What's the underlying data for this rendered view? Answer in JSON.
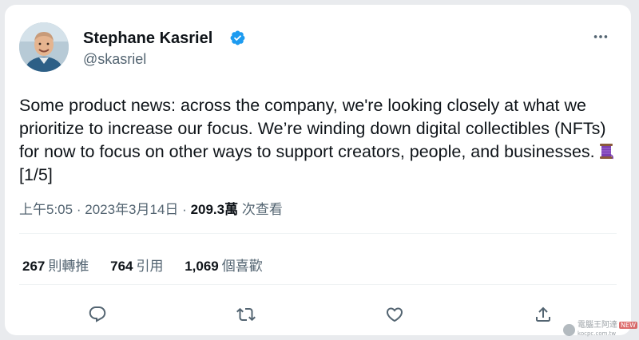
{
  "author": {
    "display_name": "Stephane Kasriel",
    "handle": "@skasriel",
    "verified": true
  },
  "tweet": {
    "text": "Some product news: across the company, we're looking closely at what we prioritize to increase our focus. We’re winding down digital collectibles (NFTs) for now to focus on other ways to support creators, people, and businesses.",
    "thread_marker": "[1/5]",
    "emoji": "spool-of-thread"
  },
  "meta": {
    "time": "上午5:05",
    "separator": "·",
    "date": "2023年3月14日",
    "views_count": "209.3萬",
    "views_label": "次查看"
  },
  "stats": [
    {
      "count": "267",
      "label": "則轉推"
    },
    {
      "count": "764",
      "label": "引用"
    },
    {
      "count": "1,069",
      "label": "個喜歡"
    }
  ],
  "actions": [
    "reply-icon",
    "retweet-icon",
    "like-icon",
    "share-icon"
  ],
  "colors": {
    "verified": "#1d9bf0",
    "text_primary": "#0f1419",
    "text_secondary": "#536471",
    "divider": "#eff3f4"
  },
  "watermark": {
    "text": "電腦王阿達",
    "site": "kocpc.com.tw",
    "tag": "NEW"
  }
}
